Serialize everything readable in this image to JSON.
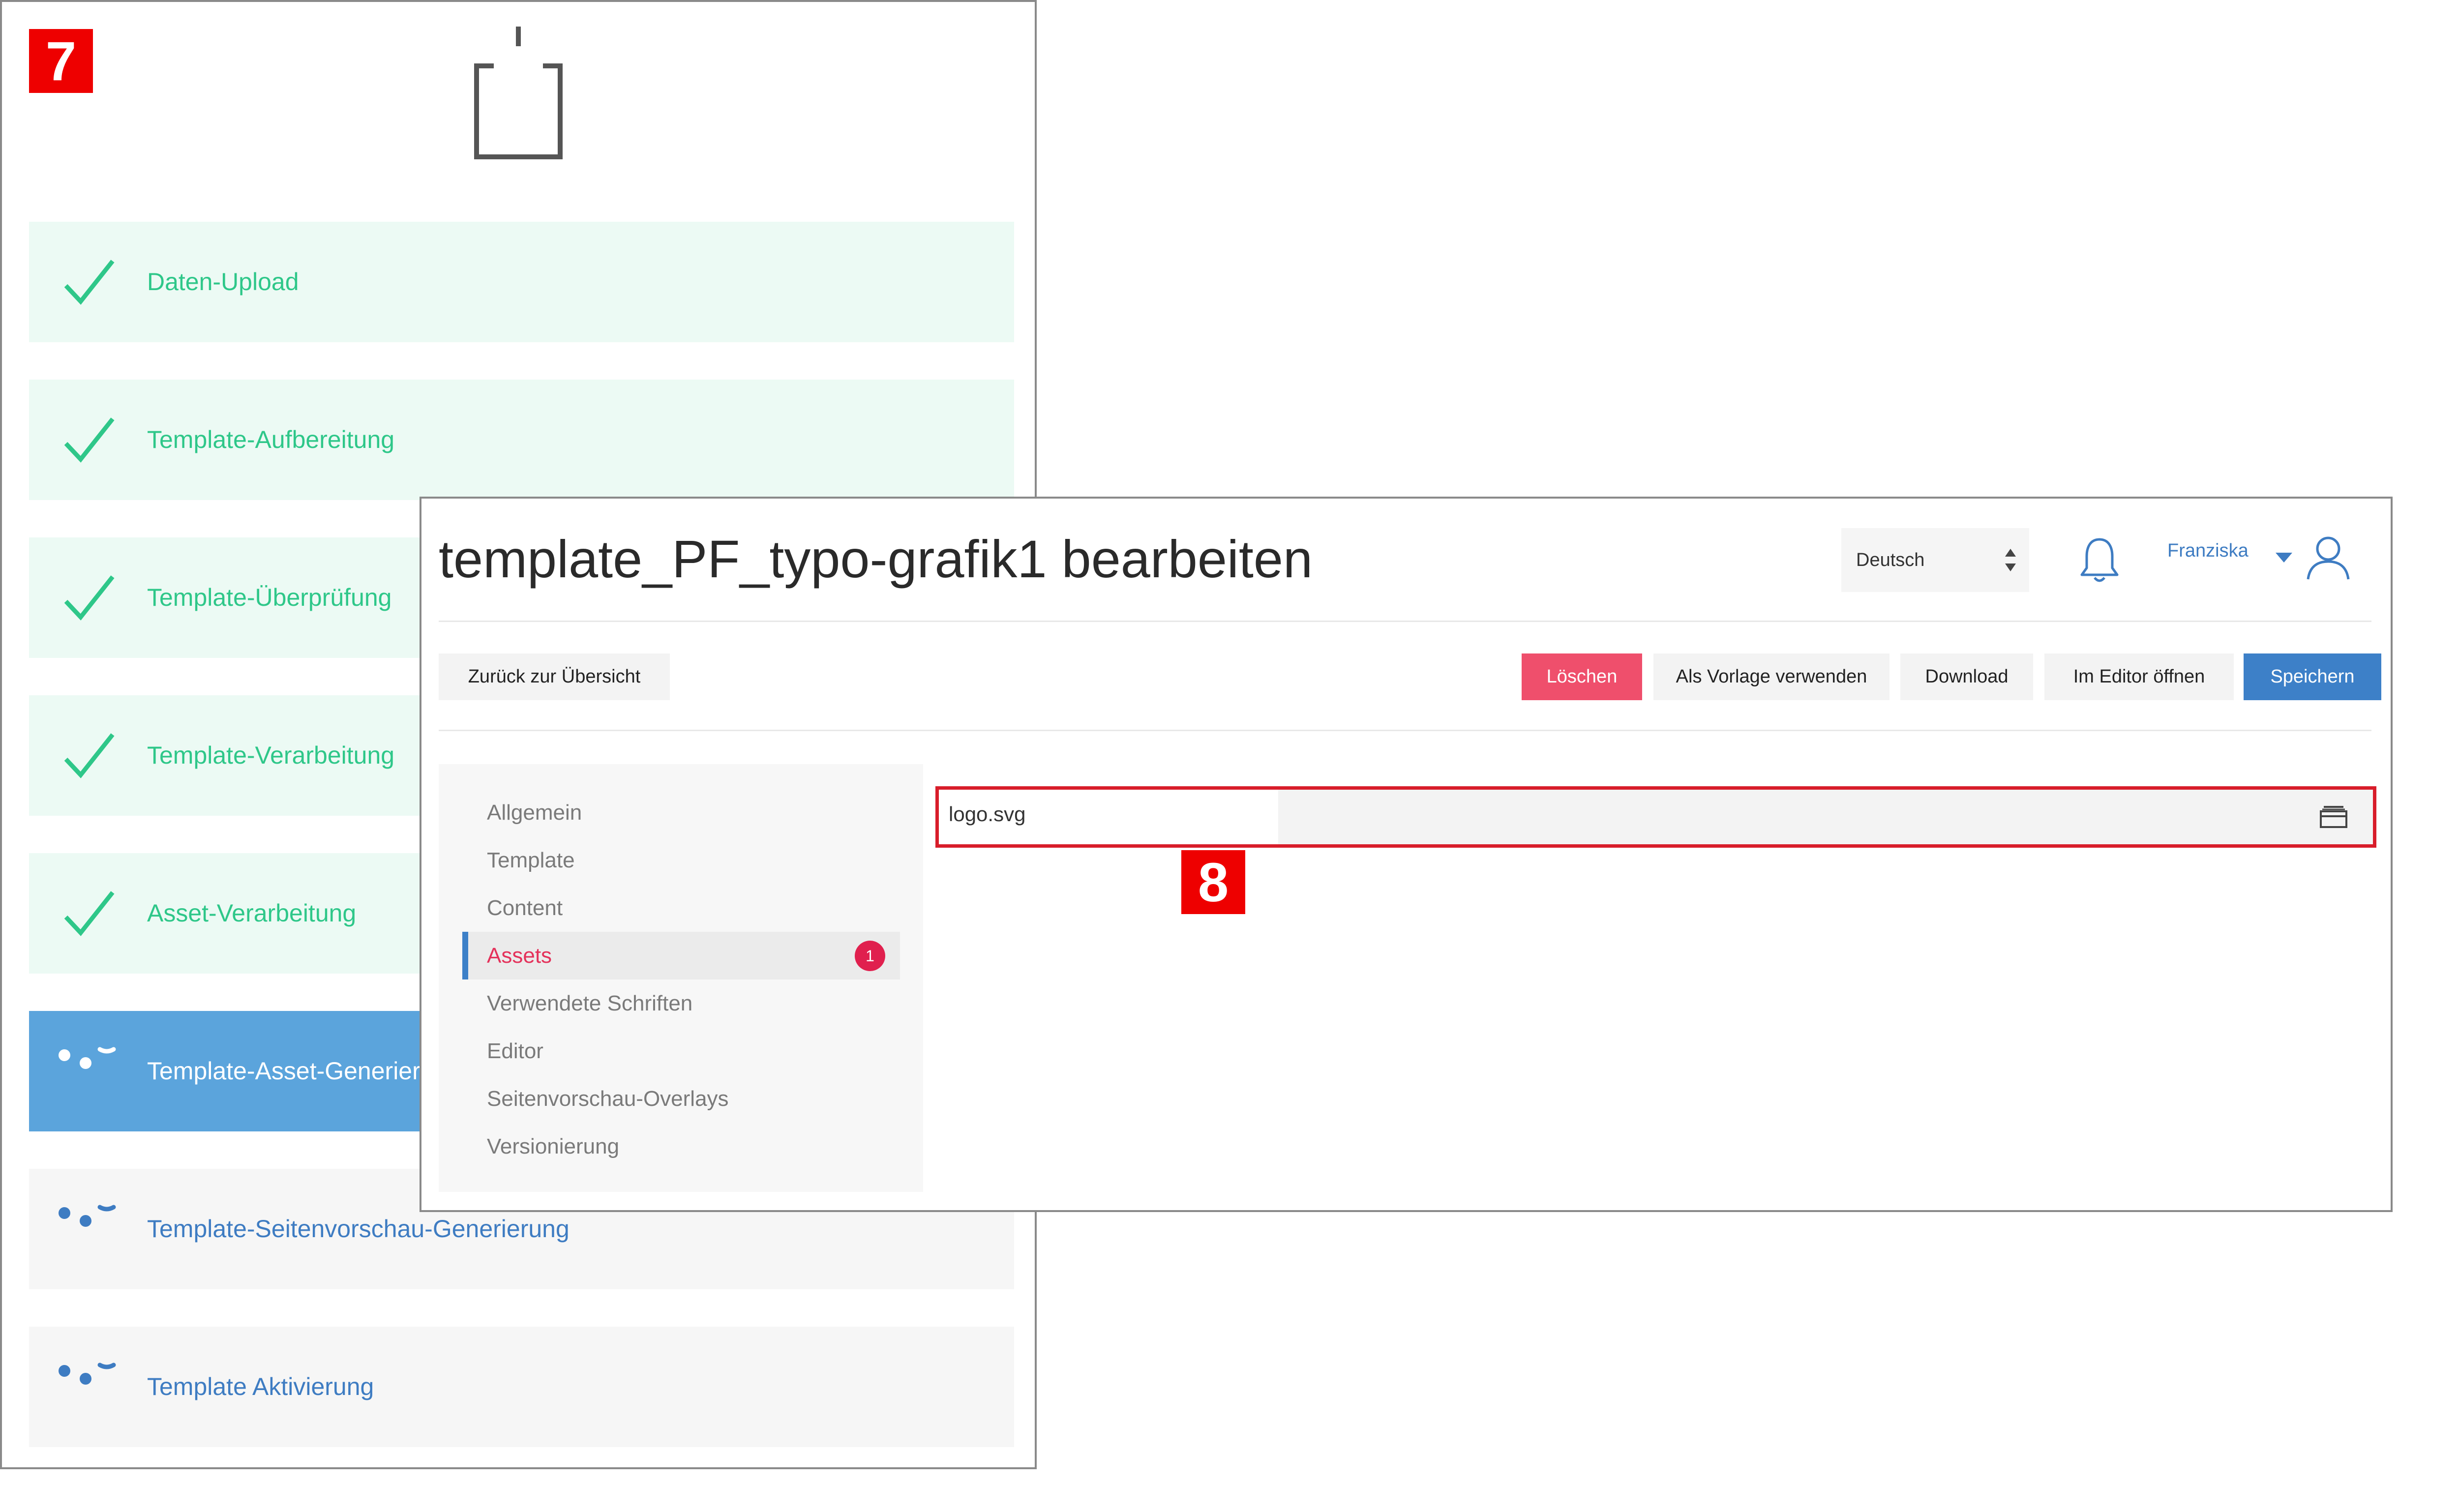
{
  "annotations": {
    "step_badge": "7",
    "edit_badge": "8"
  },
  "steps": [
    {
      "label": "Daten-Upload",
      "status": "done",
      "icon": "checkmark-icon"
    },
    {
      "label": "Template-Aufbereitung",
      "status": "done",
      "icon": "checkmark-icon"
    },
    {
      "label": "Template-Überprüfung",
      "status": "done",
      "icon": "checkmark-icon"
    },
    {
      "label": "Template-Verarbeitung",
      "status": "done",
      "icon": "checkmark-icon"
    },
    {
      "label": "Asset-Verarbeitung",
      "status": "done",
      "icon": "checkmark-icon"
    },
    {
      "label": "Template-Asset-Generierung",
      "status": "active",
      "icon": "spinner-dots-icon"
    },
    {
      "label": "Template-Seitenvorschau-Generierung",
      "status": "pending",
      "icon": "spinner-dots-icon"
    },
    {
      "label": "Template Aktivierung",
      "status": "pending",
      "icon": "spinner-dots-icon"
    }
  ],
  "editor": {
    "title": "template_PF_typo-grafik1 bearbeiten",
    "language": {
      "selected": "Deutsch"
    },
    "user": {
      "name": "Franziska"
    },
    "toolbar": {
      "back_label": "Zurück zur Übersicht",
      "delete_label": "Löschen",
      "as_template_label": "Als Vorlage verwenden",
      "download_label": "Download",
      "open_editor_label": "Im Editor öffnen",
      "save_label": "Speichern"
    },
    "sidenav": {
      "items": [
        {
          "label": "Allgemein"
        },
        {
          "label": "Template"
        },
        {
          "label": "Content"
        },
        {
          "label": "Assets",
          "active": true,
          "count": "1"
        },
        {
          "label": "Verwendete Schriften"
        },
        {
          "label": "Editor"
        },
        {
          "label": "Seitenvorschau-Overlays"
        },
        {
          "label": "Versionierung"
        }
      ]
    },
    "asset": {
      "filename": "logo.svg"
    }
  },
  "colors": {
    "done_text": "#2ec789",
    "done_bg": "#ecfaf4",
    "active_bg": "#5ba4dc",
    "pending_text": "#3e7cc2",
    "delete_button": "#ef4f6c",
    "save_button": "#3d80c8",
    "annotation_badge": "#ee0000",
    "highlight_border": "#d81d2a"
  }
}
